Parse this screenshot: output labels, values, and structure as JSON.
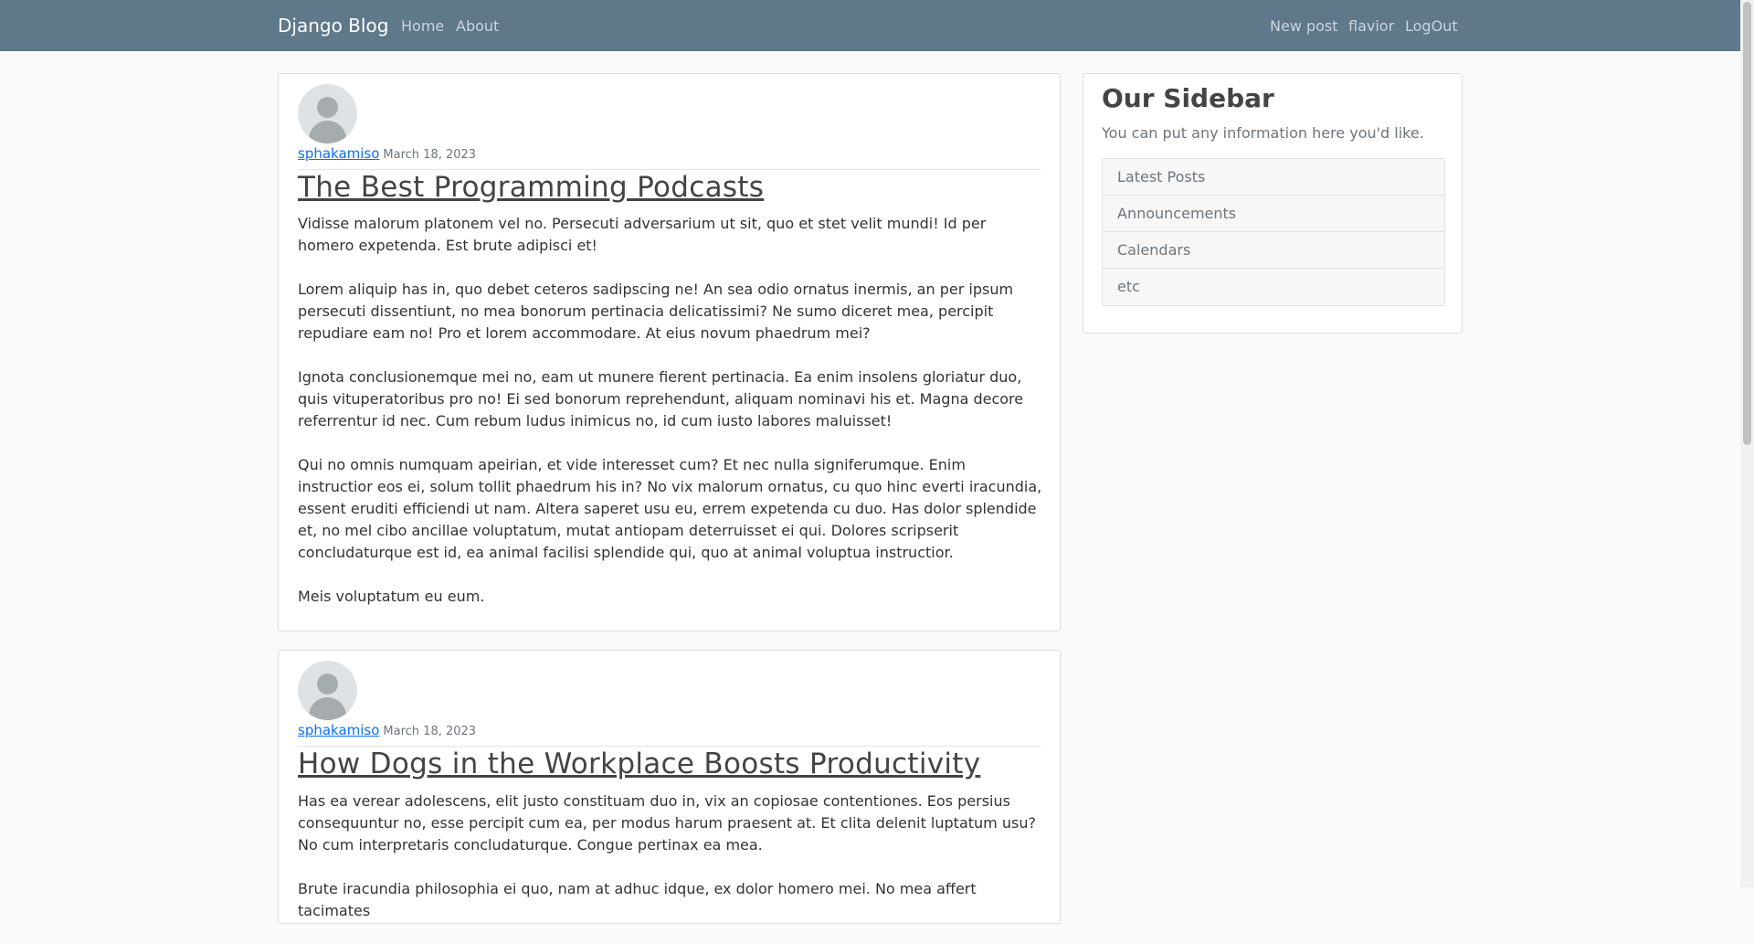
{
  "navbar": {
    "brand": "Django Blog",
    "left_links": [
      "Home",
      "About"
    ],
    "right_links": [
      "New post",
      "flavior",
      "LogOut"
    ]
  },
  "posts": [
    {
      "author": "sphakamiso",
      "date": "March 18, 2023",
      "title": "The Best Programming Podcasts",
      "paragraphs": [
        "Vidisse malorum platonem vel no. Persecuti adversarium ut sit, quo et stet velit mundi! Id per homero expetenda. Est brute adipisci et!",
        "Lorem aliquip has in, quo debet ceteros sadipscing ne! An sea odio ornatus inermis, an per ipsum persecuti dissentiunt, no mea bonorum pertinacia delicatissimi? Ne sumo diceret mea, percipit repudiare eam no! Pro et lorem accommodare. At eius novum phaedrum mei?",
        "Ignota conclusionemque mei no, eam ut munere fierent pertinacia. Ea enim insolens gloriatur duo, quis vituperatoribus pro no! Ei sed bonorum reprehendunt, aliquam nominavi his et. Magna decore referrentur id nec. Cum rebum ludus inimicus no, id cum iusto labores maluisset!",
        "Qui no omnis numquam apeirian, et vide interesset cum? Et nec nulla signiferumque. Enim instructior eos ei, solum tollit phaedrum his in? No vix malorum ornatus, cu quo hinc everti iracundia, essent eruditi efficiendi ut nam. Altera saperet usu eu, errem expetenda cu duo. Has dolor splendide et, no mel cibo ancillae voluptatum, mutat antiopam deterruisset ei qui. Dolores scripserit concludaturque est id, ea animal facilisi splendide qui, quo at animal voluptua instructior.",
        "Meis voluptatum eu eum."
      ]
    },
    {
      "author": "sphakamiso",
      "date": "March 18, 2023",
      "title": "How Dogs in the Workplace Boosts Productivity",
      "paragraphs": [
        "Has ea verear adolescens, elit justo constituam duo in, vix an copiosae contentiones. Eos persius consequuntur no, esse percipit cum ea, per modus harum praesent at. Et clita delenit luptatum usu? No cum interpretaris concludaturque. Congue pertinax ea mea.",
        "Brute iracundia philosophia ei quo, nam at adhuc idque, ex dolor homero mei. No mea affert tacimates"
      ]
    }
  ],
  "sidebar": {
    "title": "Our Sidebar",
    "text": "You can put any information here you'd like.",
    "items": [
      "Latest Posts",
      "Announcements",
      "Calendars",
      "etc"
    ]
  }
}
